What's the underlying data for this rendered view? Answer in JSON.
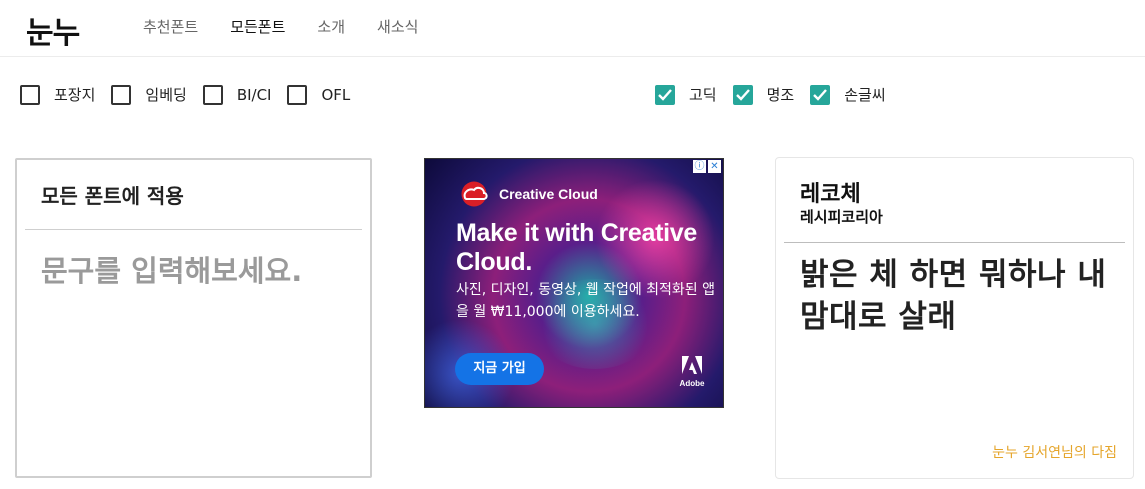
{
  "header": {
    "logo": "눈누",
    "nav": [
      "추천폰트",
      "모든폰트",
      "소개",
      "새소식"
    ],
    "active_nav": "모든폰트"
  },
  "filters": {
    "license": [
      {
        "label": "포장지",
        "checked": false
      },
      {
        "label": "임베딩",
        "checked": false
      },
      {
        "label": "BI/CI",
        "checked": false
      },
      {
        "label": "OFL",
        "checked": false
      }
    ],
    "category": [
      {
        "label": "고딕",
        "checked": true
      },
      {
        "label": "명조",
        "checked": true
      },
      {
        "label": "손글씨",
        "checked": true
      }
    ],
    "check_color": "#26a69a"
  },
  "apply_card": {
    "title": "모든 폰트에 적용",
    "placeholder": "문구를 입력해보세요."
  },
  "ad": {
    "brand": "Creative Cloud",
    "headline": "Make it with Creative Cloud.",
    "body": "사진, 디자인, 동영상, 웹 작업에 최적화된 앱을 월 ₩11,000에 이용하세요.",
    "cta": "지금 가입",
    "vendor": "Adobe",
    "adchoices_icons": [
      "ⓘ",
      "✕"
    ],
    "cta_color": "#1473e6"
  },
  "font_card": {
    "name": "레코체",
    "foundry": "레시피코리아",
    "sample": "밝은 체 하면 뭐하나 내 맘대로 살래",
    "credit": "눈누 김서연님의 다짐",
    "credit_color": "#e5a52b"
  }
}
